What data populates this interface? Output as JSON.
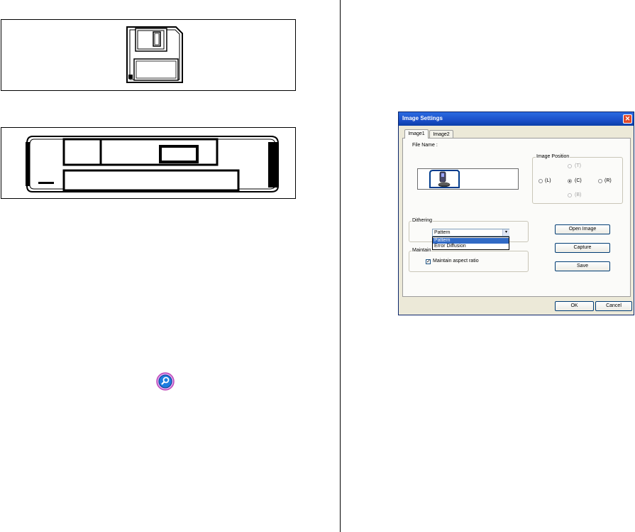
{
  "dialog": {
    "title": "Image Settings",
    "close_glyph": "✕",
    "tabs": [
      {
        "label": "Image1"
      },
      {
        "label": "Image2"
      }
    ],
    "file_name_label": "File Name :",
    "image_position": {
      "legend": "Image Position",
      "options": [
        {
          "label": "(T)",
          "selected": false,
          "enabled": false
        },
        {
          "label": "(L)",
          "selected": false,
          "enabled": true
        },
        {
          "label": "(C)",
          "selected": true,
          "enabled": true
        },
        {
          "label": "(R)",
          "selected": false,
          "enabled": true
        },
        {
          "label": "(B)",
          "selected": false,
          "enabled": false
        }
      ]
    },
    "dithering": {
      "legend": "Dithering",
      "selected": "Pattern",
      "options": [
        "Pattern",
        "Error Diffusion"
      ]
    },
    "maintain": {
      "legend": "Maintain",
      "checkbox_label": "Maintain aspect ratio",
      "checked": true,
      "check_glyph": "✓"
    },
    "buttons": {
      "open_image": "Open Image",
      "capture": "Capture",
      "save": "Save",
      "ok": "OK",
      "cancel": "Cancel"
    }
  },
  "icons": {
    "floppy": "floppy-disk-icon",
    "cartridge": "cartridge-icon",
    "search": "search-icon",
    "phone": "phone-icon"
  },
  "colors": {
    "titlebar": "#1a4fc9",
    "close_button": "#e04a2a",
    "dialog_bg": "#ece9d8",
    "selection": "#316ac5",
    "search_ring": "#c04ab8"
  }
}
